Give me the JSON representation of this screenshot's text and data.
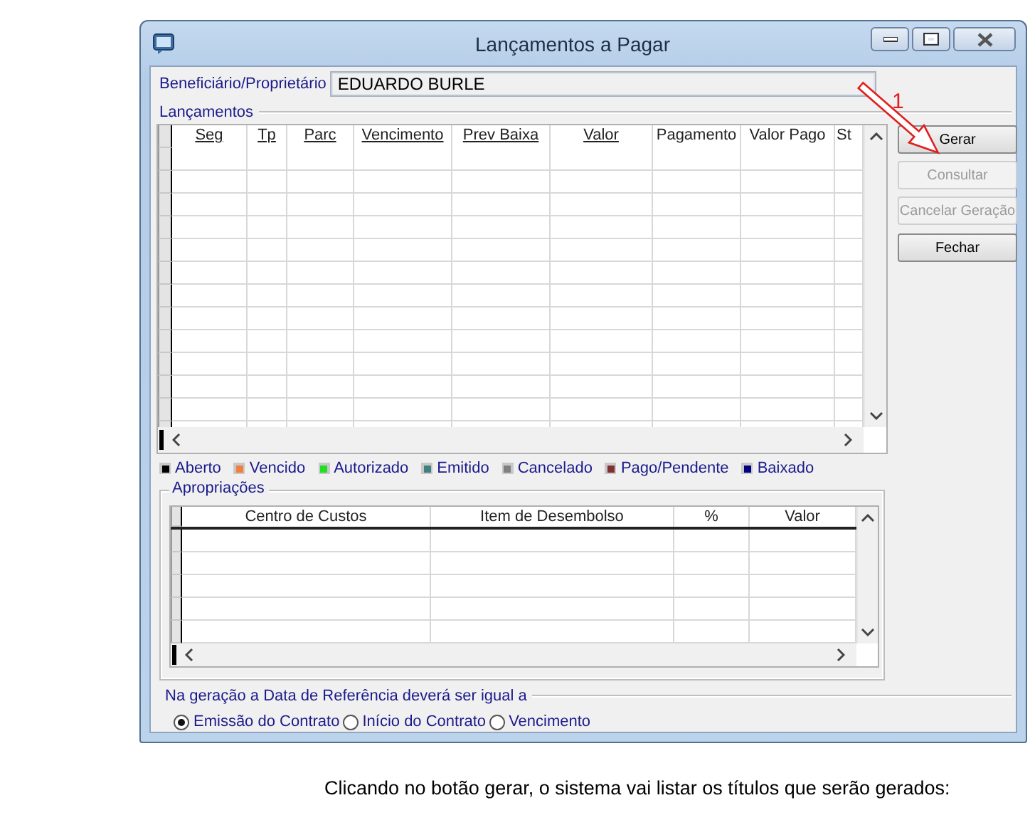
{
  "window": {
    "title": "Lançamentos a Pagar"
  },
  "beneficiary": {
    "label": "Beneficiário/Proprietário",
    "value": "EDUARDO BURLE"
  },
  "entries": {
    "title": "Lançamentos",
    "columns": [
      {
        "label": "Seg",
        "underlined": true
      },
      {
        "label": "Tp",
        "underlined": true
      },
      {
        "label": "Parc",
        "underlined": true
      },
      {
        "label": "Vencimento",
        "underlined": true
      },
      {
        "label": "Prev Baixa",
        "underlined": true
      },
      {
        "label": "Valor",
        "underlined": true
      },
      {
        "label": "Pagamento",
        "underlined": false
      },
      {
        "label": "Valor Pago",
        "underlined": false
      },
      {
        "label": "St",
        "underlined": false
      }
    ]
  },
  "buttons": [
    {
      "label": "Gerar",
      "disabled": false
    },
    {
      "label": "Consultar",
      "disabled": true
    },
    {
      "label": "Cancelar Geração",
      "disabled": true
    },
    {
      "label": "Fechar",
      "disabled": false
    }
  ],
  "legend": [
    {
      "label": "Aberto",
      "color": "#000000"
    },
    {
      "label": "Vencido",
      "color": "#f08040"
    },
    {
      "label": "Autorizado",
      "color": "#20e020"
    },
    {
      "label": "Emitido",
      "color": "#408080"
    },
    {
      "label": "Cancelado",
      "color": "#808080"
    },
    {
      "label": "Pago/Pendente",
      "color": "#803030"
    },
    {
      "label": "Baixado",
      "color": "#000080"
    }
  ],
  "appropriations": {
    "title": "Apropriações",
    "columns": [
      {
        "label": "Centro de Custos"
      },
      {
        "label": "Item de Desembolso"
      },
      {
        "label": "%"
      },
      {
        "label": "Valor"
      }
    ]
  },
  "reference_date": {
    "title": "Na geração a Data de Referência deverá ser igual a",
    "options": [
      {
        "label": "Emissão do Contrato",
        "selected": true
      },
      {
        "label": "Início do Contrato",
        "selected": false
      },
      {
        "label": "Vencimento",
        "selected": false
      }
    ]
  },
  "annotation": {
    "label": "1"
  },
  "caption": "Clicando no botão gerar, o sistema vai listar os títulos que serão gerados:"
}
